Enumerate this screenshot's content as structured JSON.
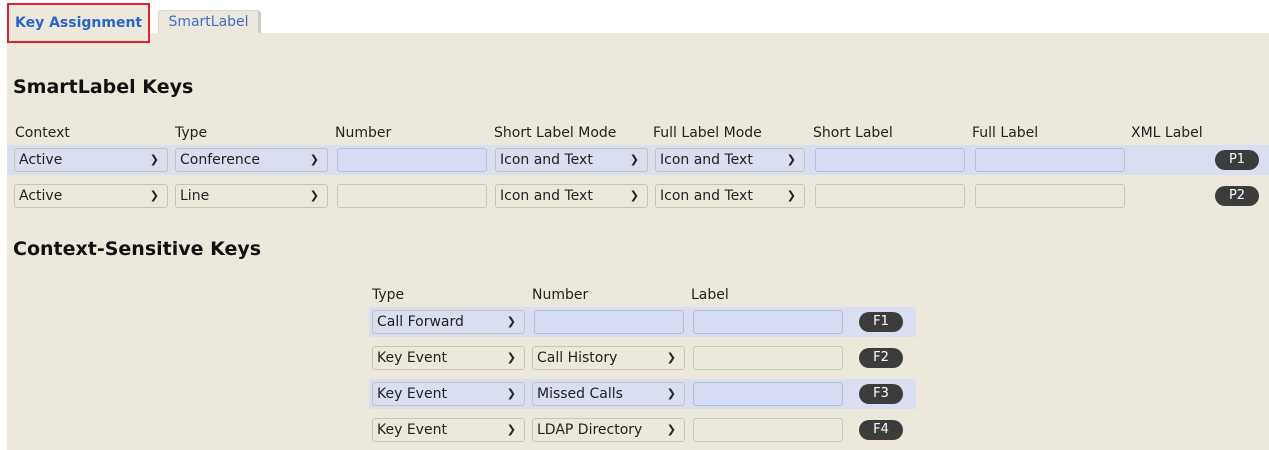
{
  "tabs": [
    {
      "label": "Key Assignment"
    },
    {
      "label": "SmartLabel"
    }
  ],
  "smartlabel": {
    "title": "SmartLabel Keys",
    "headers": {
      "context": "Context",
      "type": "Type",
      "number": "Number",
      "short_mode": "Short Label Mode",
      "full_mode": "Full Label Mode",
      "short_label": "Short Label",
      "full_label": "Full Label",
      "xml_label": "XML Label"
    },
    "rows": [
      {
        "context": "Active",
        "type": "Conference",
        "number": "",
        "short_mode": "Icon and Text",
        "full_mode": "Icon and Text",
        "short_label": "",
        "full_label": "",
        "key": "P1"
      },
      {
        "context": "Active",
        "type": "Line",
        "number": "",
        "short_mode": "Icon and Text",
        "full_mode": "Icon and Text",
        "short_label": "",
        "full_label": "",
        "key": "P2"
      }
    ]
  },
  "context_keys": {
    "title": "Context-Sensitive Keys",
    "headers": {
      "type": "Type",
      "number": "Number",
      "label": "Label"
    },
    "rows": [
      {
        "type": "Call Forward",
        "number": "",
        "label": "",
        "key": "F1"
      },
      {
        "type": "Key Event",
        "number": "Call History",
        "label": "",
        "key": "F2"
      },
      {
        "type": "Key Event",
        "number": "Missed Calls",
        "label": "",
        "key": "F3"
      },
      {
        "type": "Key Event",
        "number": "LDAP Directory",
        "label": "",
        "key": "F4"
      }
    ]
  },
  "icons": {
    "dropdown": "chevron-down-icon"
  },
  "colors": {
    "active_tab_text": "#2a63c9",
    "active_tab_border": "#e2222a",
    "panel_bg": "#ece9dc",
    "highlight_row": "#d9def0",
    "key_pill": "#3c3c3c"
  }
}
